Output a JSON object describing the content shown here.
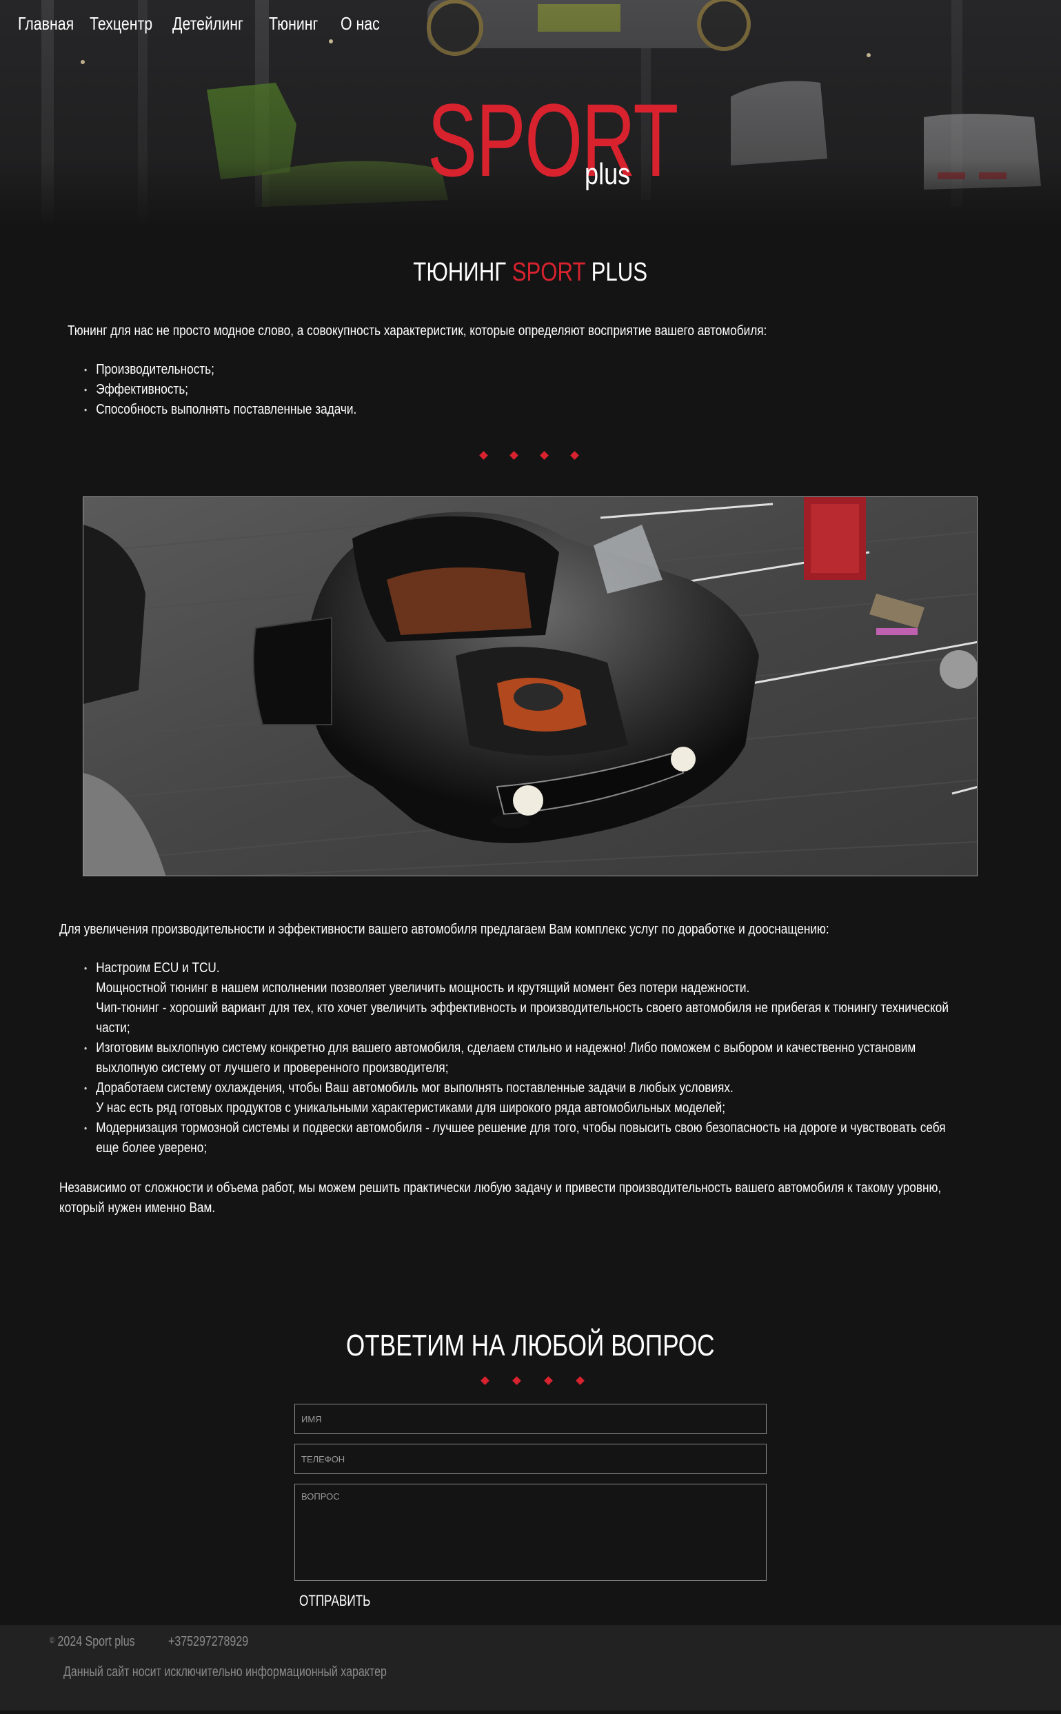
{
  "nav": {
    "items": [
      {
        "label": "Главная"
      },
      {
        "label": "Техцентр"
      },
      {
        "label": "Детейлинг"
      },
      {
        "label": "Тюнинг"
      },
      {
        "label": "О нас"
      }
    ]
  },
  "logo": {
    "sport": "SPORT",
    "plus": "plus"
  },
  "main": {
    "title_prefix": "ТЮНИНГ ",
    "title_accent": "SPORT",
    "title_suffix": " PLUS",
    "intro": "Тюнинг для нас не просто модное слово, а совокупность характеристик, которые определяют восприятие вашего автомобиля:",
    "qualities": [
      "Производительность;",
      "Эффективность;",
      "Способность выполнять поставленные задачи."
    ],
    "services_intro": "Для увеличения производительности и эффективности вашего автомобиля предлагаем Вам комплекс услуг по доработке и дооснащению:",
    "services": [
      {
        "lines": [
          "Настроим ECU и TCU.",
          "Мощностной тюнинг в нашем исполнении позволяет увеличить мощность и крутящий момент без потери надежности.",
          "Чип-тюнинг - хороший вариант для тех, кто хочет увеличить эффективность и производительность своего автомобиля не прибегая к тюнингу технической части;"
        ]
      },
      {
        "lines": [
          "Изготовим выхлопную систему конкретно для вашего автомобиля, сделаем стильно и надежно! Либо поможем с выбором и качественно установим выхлопную систему от лучшего и проверенного производителя;"
        ]
      },
      {
        "lines": [
          "Доработаем систему охлаждения, чтобы Ваш автомобиль мог выполнять поставленные задачи в любых условиях.",
          "У нас есть ряд готовых продуктов с уникальными характеристиками для широкого ряда автомобильных моделей;"
        ]
      },
      {
        "lines": [
          "Модернизация тормозной системы и подвески автомобиля - лучшее решение для того, чтобы повысить свою безопасность на дороге и чувствовать себя еще более уверено;"
        ]
      }
    ],
    "conclusion": "Независимо от сложности и объема работ, мы можем решить практически любую задачу и привести производительность вашего автомобиля к такому уровню, который нужен именно Вам."
  },
  "form": {
    "title": "ОТВЕТИМ НА ЛЮБОЙ ВОПРОС",
    "name_placeholder": "ИМЯ",
    "phone_placeholder": "ТЕЛЕФОН",
    "question_placeholder": "ВОПРОС",
    "submit_label": "ОТПРАВИТЬ"
  },
  "footer": {
    "copyright_symbol": "©",
    "copyright": " 2024 Sport plus",
    "phone": "+375297278929",
    "disclaimer": "Данный сайт носит исключительно информационный характер"
  },
  "colors": {
    "accent": "#d8232f",
    "background": "#141414",
    "footer_background": "#222222"
  },
  "icons": {
    "divider": "diamond-icon"
  }
}
